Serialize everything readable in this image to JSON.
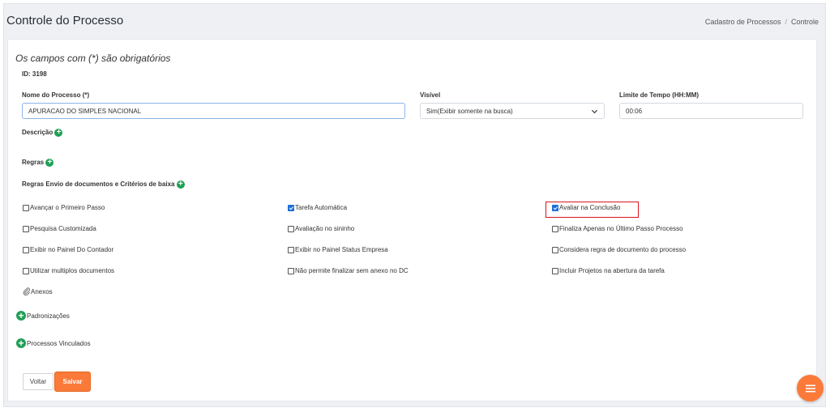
{
  "header": {
    "title": "Controle do Processo",
    "breadcrumb": [
      "Cadastro de Processos",
      "/",
      "Controle"
    ]
  },
  "form": {
    "required_note": "Os campos com (*) são obrigatórios",
    "id_text": "ID: 3198",
    "nome": {
      "label": "Nome do Processo (*)",
      "value": "APURACAO DO SIMPLES NACIONAL"
    },
    "visivel": {
      "label": "Visível",
      "value": "Sim(Exibir somente na busca)"
    },
    "limite": {
      "label": "Limite de Tempo (HH:MM)",
      "value": "00:06"
    },
    "descricao_label": "Descrição",
    "regras_label": "Regras",
    "regras_envio_label": "Regras Envio de documentos e Critérios de baixa",
    "checkboxes": [
      {
        "label": "Avançar o Primeiro Passo",
        "checked": false
      },
      {
        "label": "Tarefa Automática",
        "checked": true
      },
      {
        "label": "Avaliar na Conclusão",
        "checked": true
      },
      {
        "label": "Pesquisa Customizada",
        "checked": false
      },
      {
        "label": "Avaliação no sininho",
        "checked": false
      },
      {
        "label": "Finaliza Apenas no Último Passo Processo",
        "checked": false
      },
      {
        "label": "Exibir no Painel Do Contador",
        "checked": false
      },
      {
        "label": "Exibir no Painel Status Empresa",
        "checked": false
      },
      {
        "label": "Considera regra de documento do processo",
        "checked": false
      },
      {
        "label": "Utilizar multiplos documentos",
        "checked": false
      },
      {
        "label": "Não permite finalizar sem anexo no DC",
        "checked": false
      },
      {
        "label": "Incluir Projetos na abertura da tarefa",
        "checked": false
      }
    ],
    "anexos_label": "Anexos",
    "padronizacoes_label": "Padronizações",
    "processos_vinculados_label": "Processos Vinculados",
    "voltar_label": "Voltar",
    "salvar_label": "Salvar"
  },
  "colors": {
    "accent": "#fb7a3a",
    "plus_icon": "#1fa055",
    "highlight_box": "#d9141c",
    "checkbox_checked": "#1e6fd6"
  },
  "icons": [
    "plus-circle-icon",
    "chevron-down-icon",
    "paperclip-icon",
    "menu-icon"
  ]
}
